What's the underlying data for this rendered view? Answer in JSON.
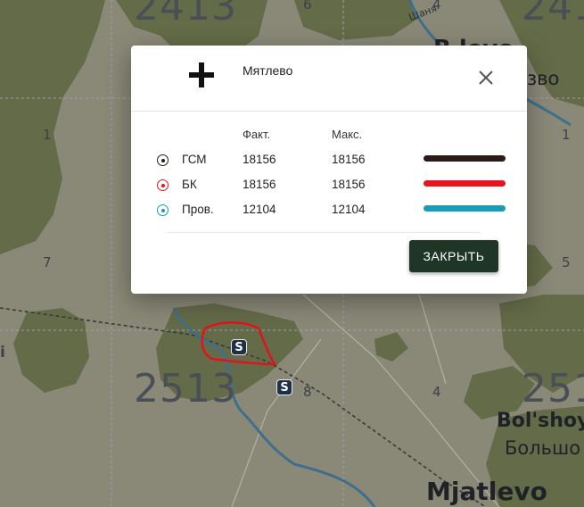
{
  "map": {
    "grid_labels": [
      "2413",
      "2513",
      "251",
      "241"
    ],
    "grid_small_labels": [
      "6",
      "1",
      "7",
      "8",
      "4",
      "5",
      "1",
      "4",
      "i",
      "1"
    ],
    "places": {
      "bolshoy": "Bol'shoy",
      "bolshoy_cyr": "Большо",
      "mjatlevo": "Mjatlevo",
      "top_partial": "B     levo",
      "top_partial_cyr": "зво",
      "stream_label": "Шаня"
    },
    "marker_label": "S",
    "colors": {
      "land": "#8a8877",
      "forest": "#646b48",
      "grid": "#9fa0a8",
      "river": "#3f6f8c",
      "road": "#b4b2a6",
      "annotation": "#e0141c"
    }
  },
  "dialog": {
    "icon": "balkenkreuz-icon",
    "title": "Мятлево",
    "close_icon": "close-icon",
    "columns": {
      "fact": "Факт.",
      "max": "Макс."
    },
    "rows": [
      {
        "name": "ГСМ",
        "fact": "18156",
        "max": "18156",
        "color": "#2b1a17"
      },
      {
        "name": "БК",
        "fact": "18156",
        "max": "18156",
        "color": "#e8141c"
      },
      {
        "name": "Пров.",
        "fact": "12104",
        "max": "12104",
        "color": "#1a9bb6"
      }
    ],
    "button_label": "ЗАКРЫТЬ"
  }
}
